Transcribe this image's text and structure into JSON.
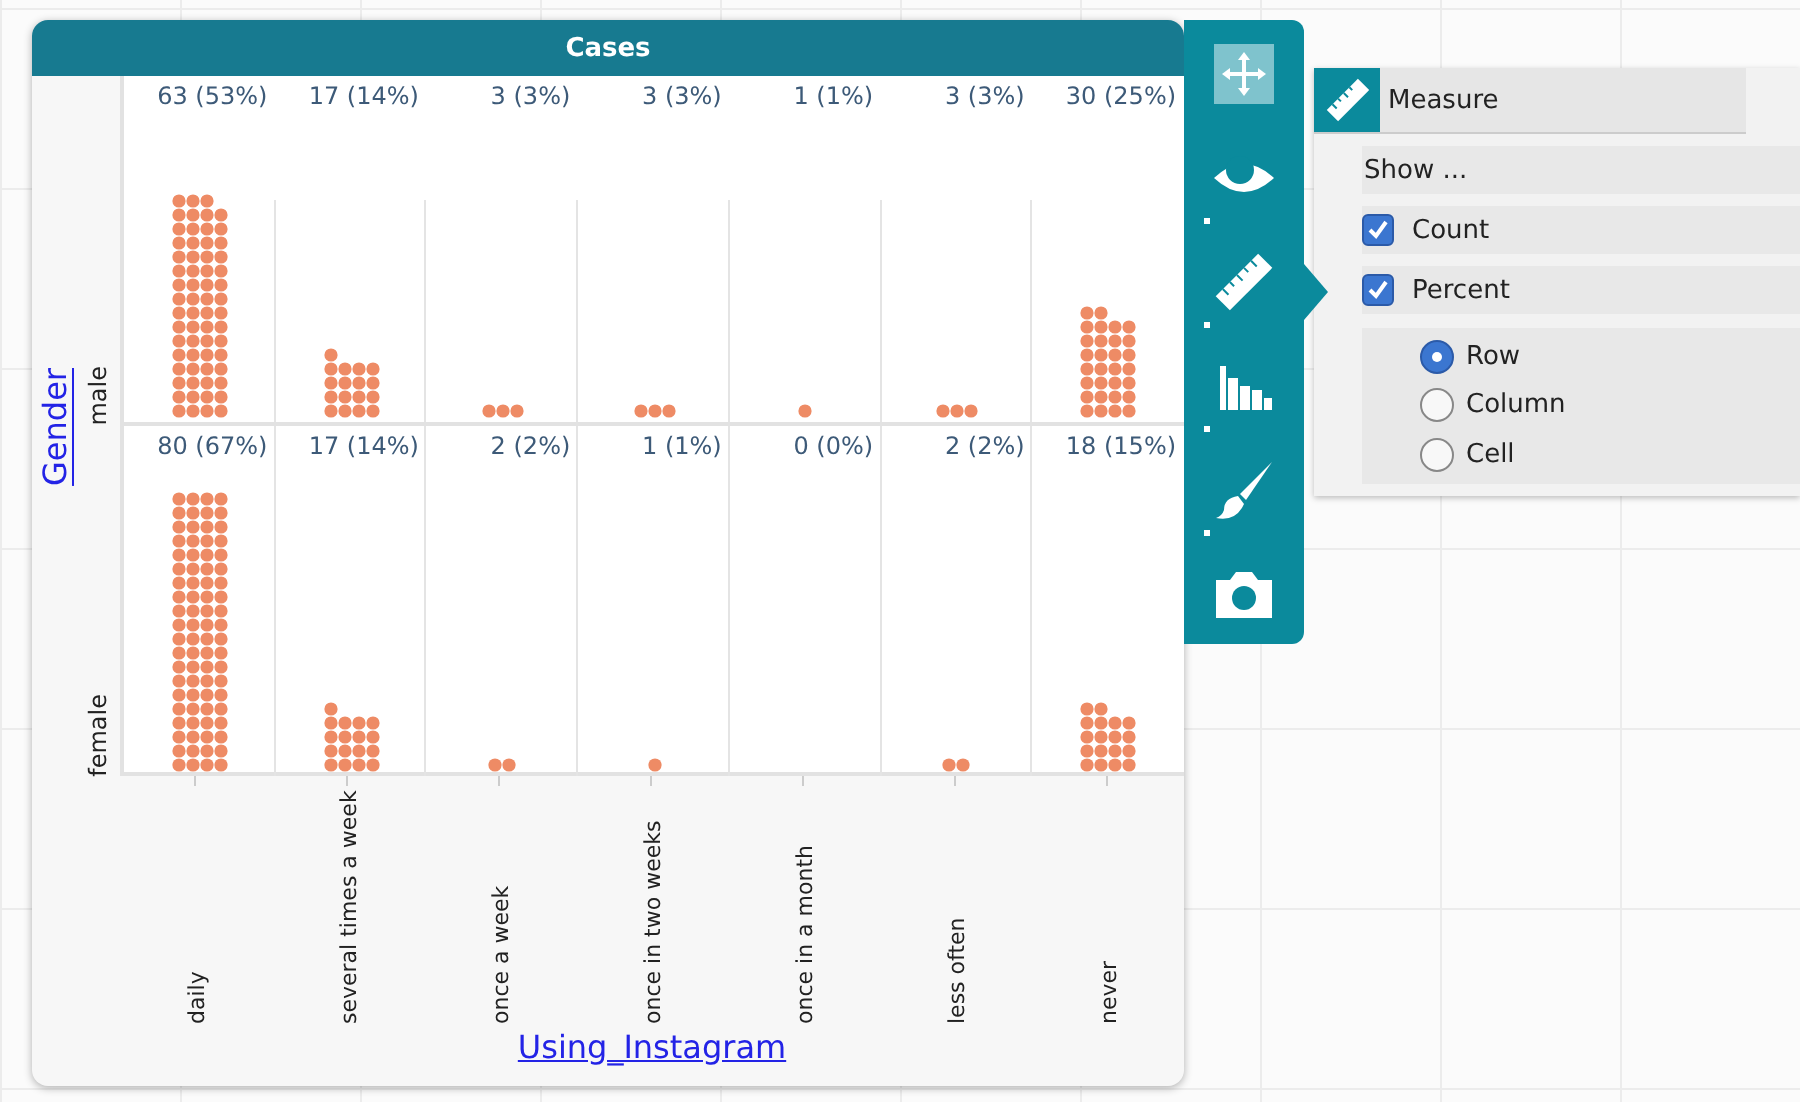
{
  "plot": {
    "title": "Cases",
    "y_attribute": "Gender",
    "x_attribute": "Using_Instagram",
    "row_labels": [
      "male",
      "female"
    ],
    "column_labels": [
      "daily",
      "several times a week",
      "once a week",
      "once in two weeks",
      "once in a month",
      "less often",
      "never"
    ],
    "rows": [
      {
        "cells": [
          "63 (53%)",
          "17 (14%)",
          "3 (3%)",
          "3 (3%)",
          "1 (1%)",
          "3 (3%)",
          "30 (25%)"
        ]
      },
      {
        "cells": [
          "80 (67%)",
          "17 (14%)",
          "2 (2%)",
          "1 (1%)",
          "0 (0%)",
          "2 (2%)",
          "18 (15%)"
        ]
      }
    ]
  },
  "toolbar": [
    {
      "kind": "move",
      "selected": false
    },
    {
      "kind": "eye",
      "selected": false
    },
    {
      "kind": "ruler",
      "selected": true
    },
    {
      "kind": "chart",
      "selected": false
    },
    {
      "kind": "brush",
      "selected": false
    },
    {
      "kind": "camera",
      "selected": false
    }
  ],
  "panel": {
    "title": "Measure",
    "heading": "Show ...",
    "options": [
      {
        "label": "Count",
        "checked": true
      },
      {
        "label": "Percent",
        "checked": true
      }
    ],
    "percent_types": [
      {
        "label": "Row",
        "selected": true
      },
      {
        "label": "Column",
        "selected": false
      },
      {
        "label": "Cell",
        "selected": false
      }
    ]
  }
}
